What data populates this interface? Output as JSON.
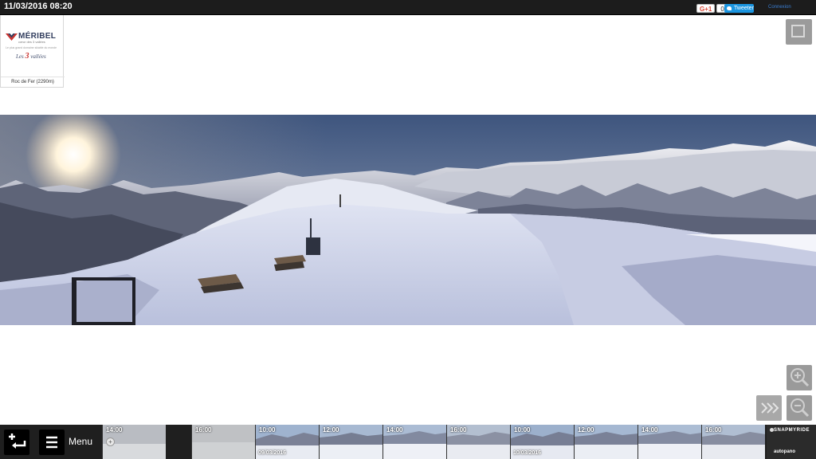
{
  "header": {
    "datetime": "11/03/2016 08:20",
    "gplus_label": "G+1",
    "gplus_count": "0",
    "tweet_label": "Tweeter",
    "login_label": "Connexion"
  },
  "logo": {
    "name": "MÉRIBEL",
    "subtitle": "cœur des 3 vallées",
    "tagline": "Le plus grand domaine skiable du monde",
    "brand_prefix": "Les",
    "brand_number": "3",
    "brand_suffix": "vallées",
    "camera_location": "Roc de Fer (2290m)"
  },
  "controls": {
    "fullscreen_icon": "fullscreen-icon",
    "zoom_in_icon": "zoom-in-icon",
    "zoom_out_icon": "zoom-out-icon",
    "next_icon": "fast-forward-icon"
  },
  "bottombar": {
    "menu_label": "Menu",
    "thumbnails": [
      {
        "time": "14:00",
        "date": ""
      },
      {
        "time": "16:00",
        "date": ""
      },
      {
        "time": "10:00",
        "date": "09/03/2016"
      },
      {
        "time": "12:00",
        "date": ""
      },
      {
        "time": "14:00",
        "date": ""
      },
      {
        "time": "16:00",
        "date": ""
      },
      {
        "time": "10:00",
        "date": "10/03/2016"
      },
      {
        "time": "12:00",
        "date": ""
      },
      {
        "time": "14:00",
        "date": ""
      },
      {
        "time": "16:00",
        "date": ""
      }
    ],
    "brand_top": "SNAPMYRIDE",
    "brand_bottom": "autopano"
  },
  "colors": {
    "topbar": "#1c1c1c",
    "sky": "#4a5f86",
    "snow": "#e9edf7",
    "accent_blue": "#1b95e0"
  }
}
